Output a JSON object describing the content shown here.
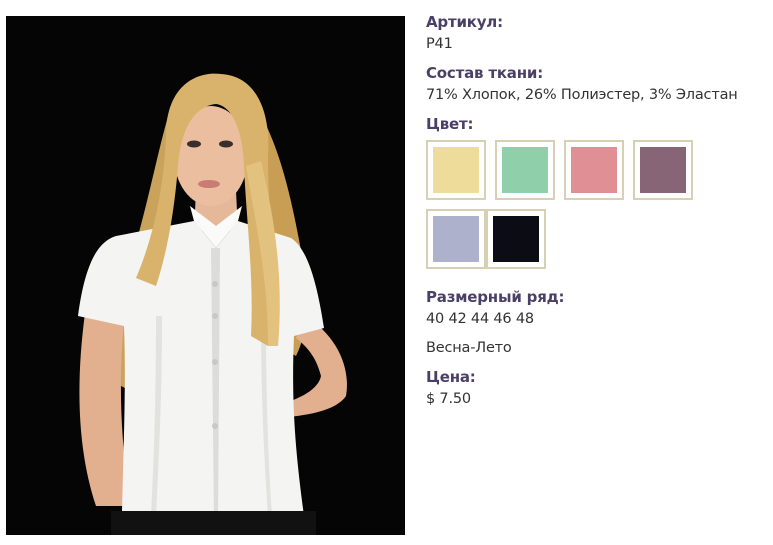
{
  "product": {
    "photo_icon": "product-photo-woman-white-shirt",
    "article_label": "Артикул:",
    "article_value": "P41",
    "fabric_label": "Состав ткани:",
    "fabric_value": "71% Хлопок, 26% Полиэстер, 3% Эластан",
    "color_label": "Цвет:",
    "colors": [
      {
        "name": "yellow",
        "hex": "#eedc9a"
      },
      {
        "name": "mint",
        "hex": "#8fcfaa"
      },
      {
        "name": "pink",
        "hex": "#e08f94"
      },
      {
        "name": "plum",
        "hex": "#876576"
      },
      {
        "name": "lavender-grey",
        "hex": "#aeb1cc"
      },
      {
        "name": "black",
        "hex": "#0c0d14"
      }
    ],
    "size_label": "Размерный ряд:",
    "size_value": "40 42 44 46 48",
    "season_value": "Весна-Лето",
    "price_label": "Цена:",
    "price_value": "$ 7.50"
  },
  "theme": {
    "label_color": "#4a3f66",
    "text_color": "#333333",
    "swatch_border": "#d8d0b4"
  }
}
